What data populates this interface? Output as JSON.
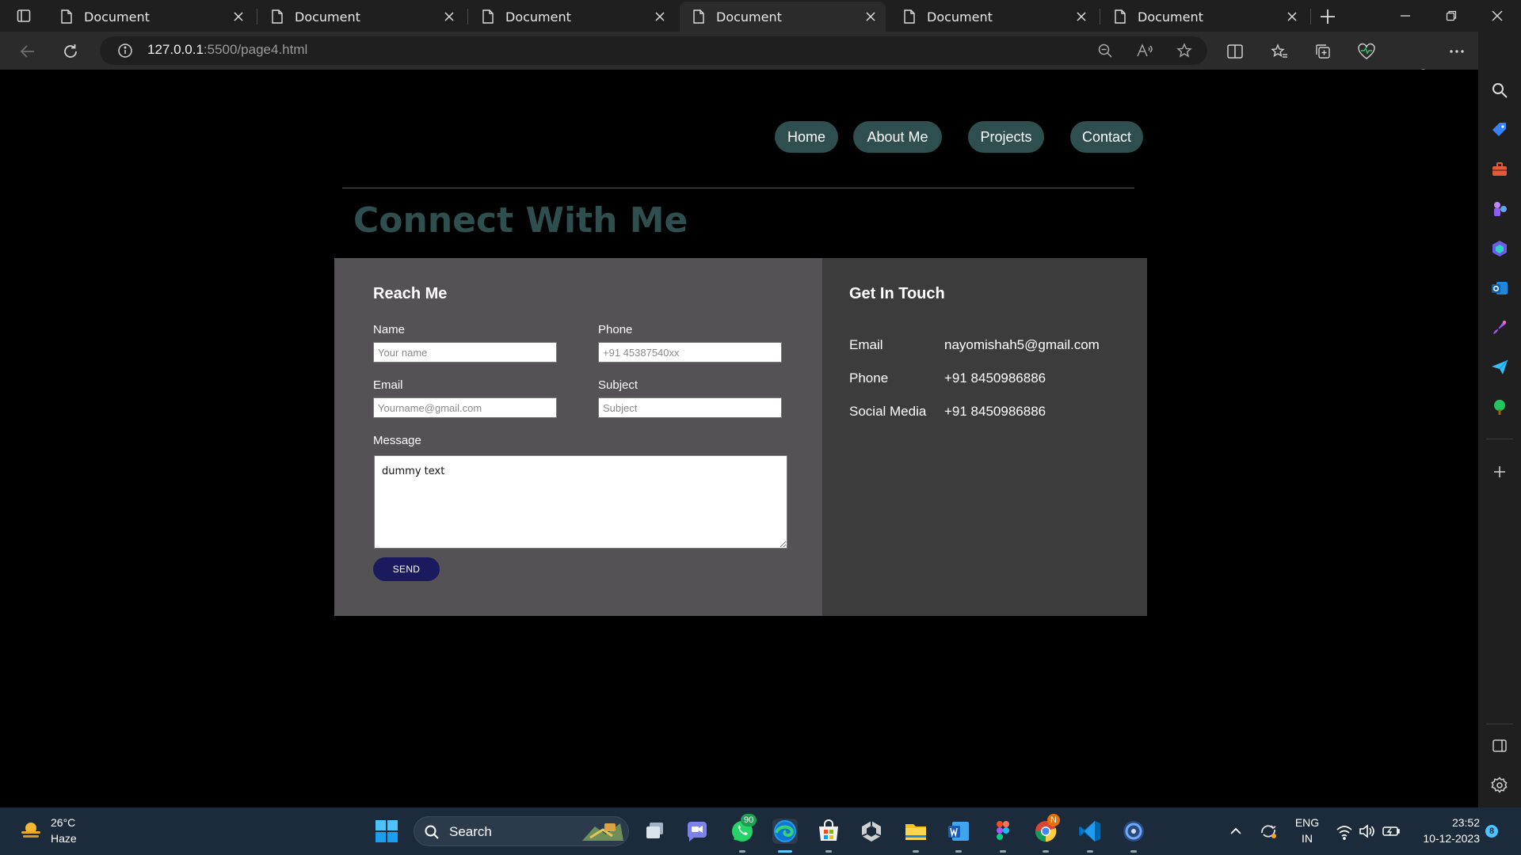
{
  "browser": {
    "tabs": [
      {
        "title": "Document",
        "active": false
      },
      {
        "title": "Document",
        "active": false
      },
      {
        "title": "Document",
        "active": false
      },
      {
        "title": "Document",
        "active": true
      },
      {
        "title": "Document",
        "active": false
      },
      {
        "title": "Document",
        "active": false
      }
    ],
    "url_host": "127.0.0.1",
    "url_rest": ":5500/page4.html"
  },
  "nav": {
    "home": "Home",
    "about": "About Me",
    "projects": "Projects",
    "contact": "Contact"
  },
  "page": {
    "heading": "Connect With Me"
  },
  "reach_form": {
    "title": "Reach Me",
    "name_label": "Name",
    "name_placeholder": "Your name",
    "phone_label": "Phone",
    "phone_placeholder": "+91 45387540xx",
    "email_label": "Email",
    "email_placeholder": "Yourname@gmail.com",
    "subject_label": "Subject",
    "subject_placeholder": "Subject",
    "message_label": "Message",
    "message_value": "dummy text",
    "send_label": "SEND"
  },
  "get_in_touch": {
    "title": "Get In Touch",
    "rows": [
      {
        "label": "Email",
        "value": "nayomishah5@gmail.com"
      },
      {
        "label": "Phone",
        "value": "+91 8450986886"
      },
      {
        "label": "Social Media",
        "value": "+91 8450986886"
      }
    ]
  },
  "taskbar": {
    "temperature": "26°C",
    "weather": "Haze",
    "search_label": "Search",
    "whatsapp_badge": "90",
    "chrome_badge": "N",
    "lang_top": "ENG",
    "lang_bottom": "IN",
    "time": "23:52",
    "date": "10-12-2023",
    "notification_count": "8"
  },
  "colors": {
    "nav_button": "#2f4f4f",
    "heading": "#2f4f4f",
    "form_panel": "#555255",
    "info_panel": "#3c3c3c",
    "send_button": "#1b1a5e"
  }
}
